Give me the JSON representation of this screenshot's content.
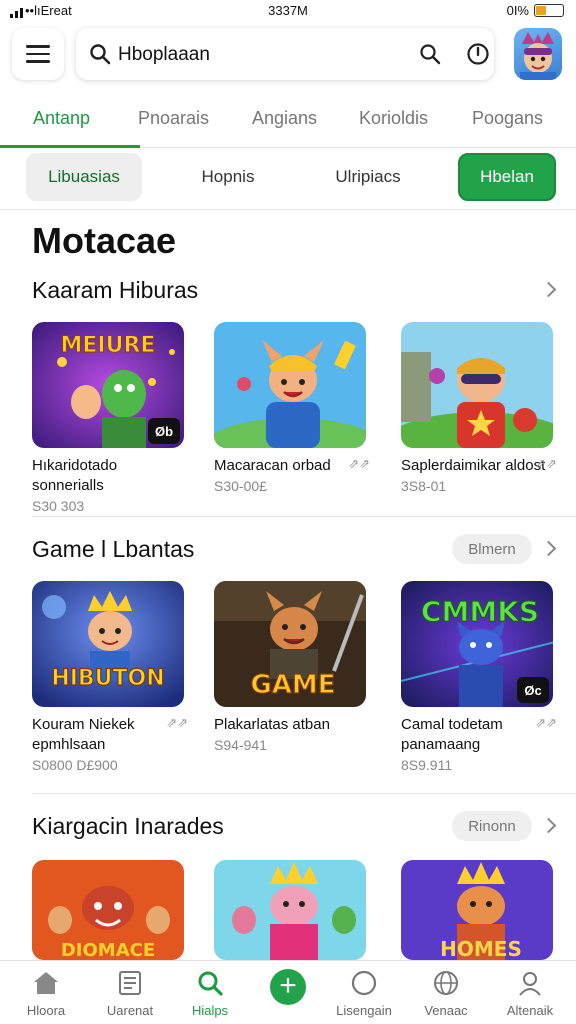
{
  "status_bar": {
    "carrier": "••lıEreat",
    "time": "3337M",
    "battery_text": "0I%"
  },
  "search": {
    "value": "Hboplaaan"
  },
  "tabs": [
    {
      "label": "Antanp",
      "active": true
    },
    {
      "label": "Pnoarais"
    },
    {
      "label": "Angians"
    },
    {
      "label": "Korioldis"
    },
    {
      "label": "Poogans"
    }
  ],
  "chips": [
    {
      "label": "Libuasias",
      "selected": true
    },
    {
      "label": "Hopnis"
    },
    {
      "label": "Ulripiacs"
    },
    {
      "label": "Hbelan",
      "primary": true
    }
  ],
  "page_title": "Motacae",
  "sections": [
    {
      "title": "Kaaram Hiburas",
      "pill": "",
      "items": [
        {
          "name": "Hıkaridotado sonnerialls",
          "price": "S30 303",
          "badge": "Øb",
          "thumb_text": "MEIURE",
          "theme": "purple"
        },
        {
          "name": "Macaracan orbad",
          "price": "S30-00£",
          "theme": "blue"
        },
        {
          "name": "Saplerdaimikar aldost",
          "price": "3S8-01",
          "theme": "green"
        }
      ]
    },
    {
      "title": "Game l Lbantas",
      "pill": "Blmern",
      "items": [
        {
          "name": "Kouram Niekek epmhlsaan",
          "price": "S0800 D£900",
          "thumb_text": "HIBUTON",
          "theme": "purple2"
        },
        {
          "name": "Plakarlatas atban",
          "price": "S94-941",
          "thumb_text": "GAME",
          "theme": "dark"
        },
        {
          "name": "Camal todetam panamaang",
          "price": "8S9.911",
          "badge": "Øc",
          "thumb_text": "CMMKS",
          "theme": "neon"
        }
      ]
    },
    {
      "title": "Kiargacin Inarades",
      "pill": "Rinonn",
      "items": [
        {
          "theme": "red",
          "thumb_text": "DIOMACE"
        },
        {
          "theme": "pink"
        },
        {
          "theme": "violet",
          "thumb_text": "HOMES"
        }
      ]
    }
  ],
  "bottom_nav": [
    {
      "label": "Hloora",
      "icon": "home-icon"
    },
    {
      "label": "Uarenat",
      "icon": "list-icon"
    },
    {
      "label": "Hialps",
      "icon": "search-icon",
      "active": true
    },
    {
      "label": "",
      "icon": "add-icon"
    },
    {
      "label": "Lisengain",
      "icon": "circle-icon"
    },
    {
      "label": "Venaac",
      "icon": "globe-icon"
    },
    {
      "label": "Altenaik",
      "icon": "profile-icon"
    }
  ],
  "colors": {
    "accent": "#22a249",
    "accent_dark": "#1f9a43"
  }
}
